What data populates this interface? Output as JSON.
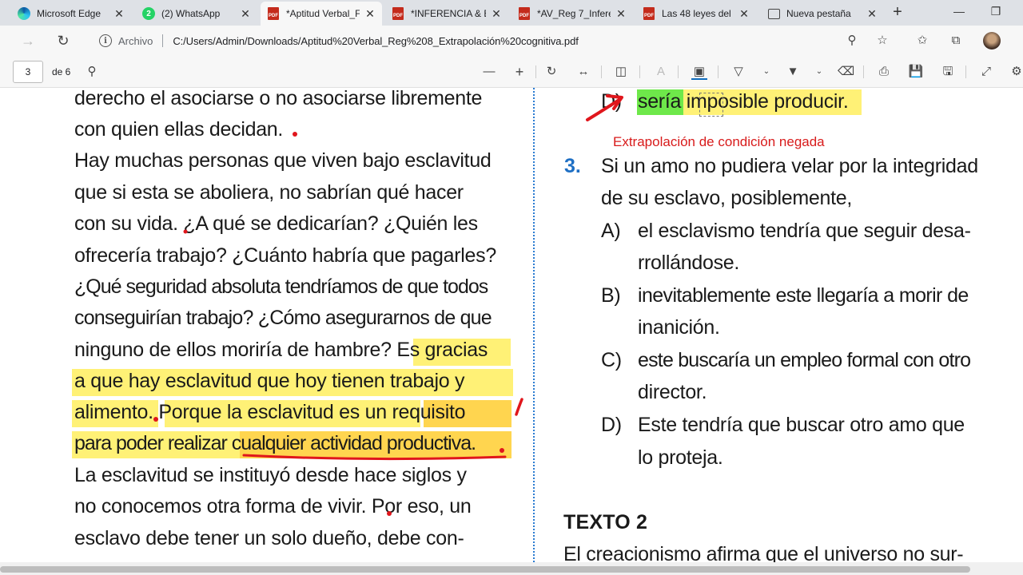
{
  "tabs": [
    {
      "label": "Microsoft Edge",
      "icon": "edge-icon"
    },
    {
      "label": "(2) WhatsApp",
      "icon": "whatsapp-icon"
    },
    {
      "label": "*Aptitud Verbal_F",
      "icon": "pdf-icon"
    },
    {
      "label": "*INFERENCIA & E",
      "icon": "pdf-icon"
    },
    {
      "label": "*AV_Reg 7_Infere",
      "icon": "pdf-icon"
    },
    {
      "label": "Las 48 leyes del p",
      "icon": "pdf-icon"
    },
    {
      "label": "Nueva pestaña",
      "icon": "new-tab-icon"
    }
  ],
  "pdf_badge": "PDF",
  "whatsapp_badge": "2",
  "address": {
    "site_label": "Archivo",
    "url": "C:/Users/Admin/Downloads/Aptitud%20Verbal_Reg%208_Extrapolación%20cognitiva.pdf"
  },
  "pdf_toolbar": {
    "page": "3",
    "total": "de 6"
  },
  "left_text": [
    "derecho el asociarse o no asociarse libremente",
    "con quien ellas decidan.",
    "Hay muchas personas que viven bajo esclavitud",
    "que si esta se aboliera, no sabrían qué hacer",
    "con su vida. ¿A qué se dedicarían? ¿Quién les",
    "ofrecería trabajo? ¿Cuánto habría que pagarles?",
    "¿Qué seguridad absoluta tendríamos de que todos",
    "conseguirían trabajo? ¿Cómo asegurarnos de que",
    "ninguno de ellos moriría de hambre? Es gracias",
    "a que hay esclavitud que hoy tienen trabajo y",
    "alimento. Porque la esclavitud es un requisito",
    "para poder realizar cualquier actividad productiva.",
    "La esclavitud se instituyó desde hace siglos y",
    "no conocemos otra forma de vivir. Por eso, un",
    "esclavo debe tener un solo dueño, debe con-"
  ],
  "right": {
    "partial_option": {
      "letter": "D)",
      "text_a": "sería",
      "text_b": " imposible producir."
    },
    "annotation": "Extrapolación de condición negada",
    "question_number": "3.",
    "question": [
      "Si un amo no pudiera velar por la integridad",
      "de su esclavo, posiblemente,"
    ],
    "options": [
      {
        "letter": "A)",
        "lines": [
          "el esclavismo tendría que seguir desa-",
          "rrollándose."
        ]
      },
      {
        "letter": "B)",
        "lines": [
          "inevitablemente este llegaría a morir de",
          "inanición."
        ]
      },
      {
        "letter": "C)",
        "lines": [
          "este buscaría un empleo formal con otro",
          "director."
        ]
      },
      {
        "letter": "D)",
        "lines": [
          "Este tendría que buscar otro amo que",
          "lo proteja."
        ]
      }
    ],
    "heading": "TEXTO 2",
    "last_line": "El creacionismo afirma que el universo no sur-"
  }
}
